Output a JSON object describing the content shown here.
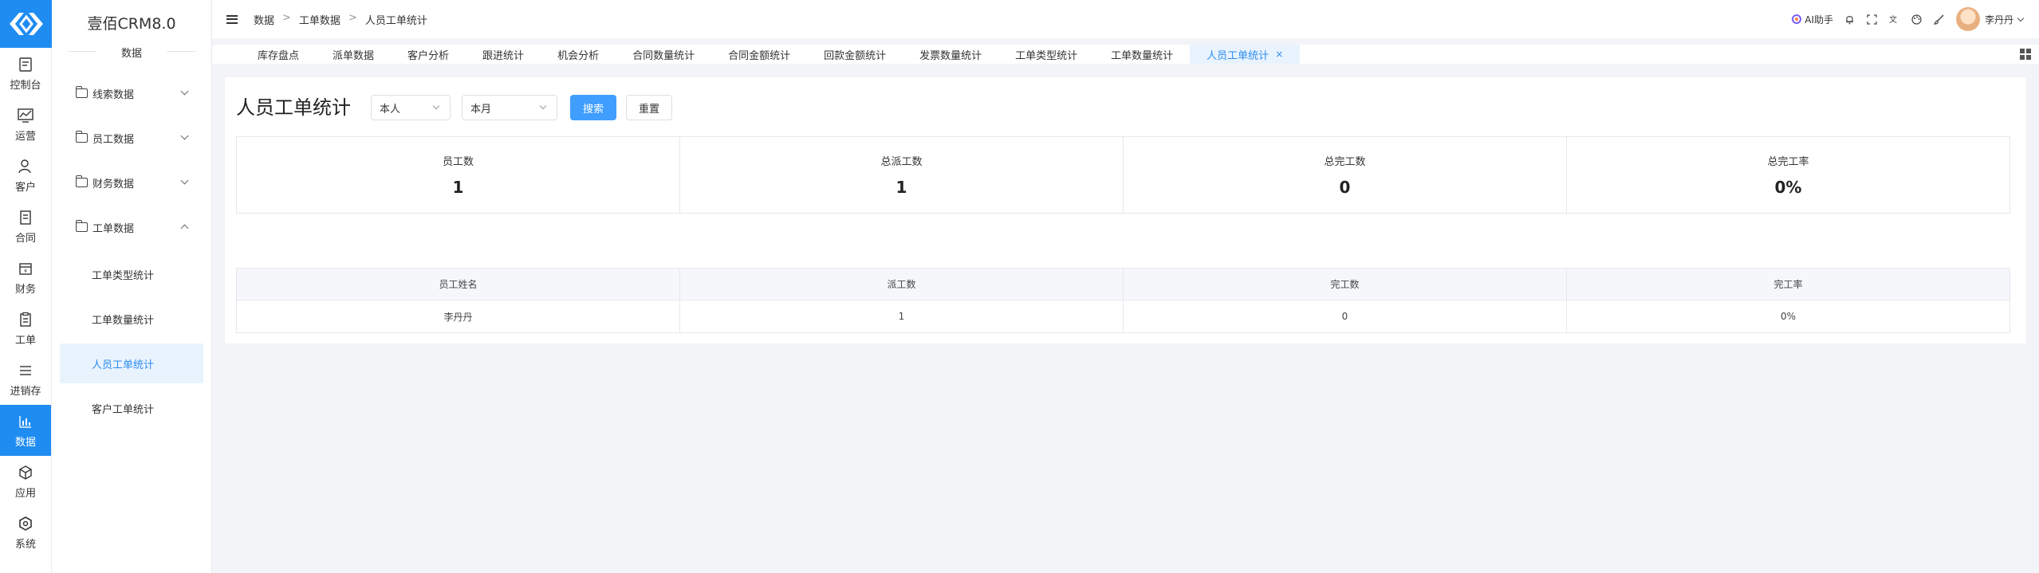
{
  "rail": {
    "items": [
      {
        "label": "控制台",
        "icon": "dashboard-icon"
      },
      {
        "label": "运营",
        "icon": "operation-icon"
      },
      {
        "label": "客户",
        "icon": "customer-icon"
      },
      {
        "label": "合同",
        "icon": "contract-icon"
      },
      {
        "label": "财务",
        "icon": "finance-icon"
      },
      {
        "label": "工单",
        "icon": "workorder-icon"
      },
      {
        "label": "进销存",
        "icon": "inventory-icon"
      },
      {
        "label": "数据",
        "icon": "data-chart-icon"
      },
      {
        "label": "应用",
        "icon": "app-cube-icon"
      },
      {
        "label": "系统",
        "icon": "system-gear-icon"
      }
    ]
  },
  "sidebar": {
    "brand": "壹佰CRM8.0",
    "section": "数据",
    "groups": [
      "线索数据",
      "员工数据",
      "财务数据",
      "工单数据"
    ],
    "leaves": [
      "工单类型统计",
      "工单数量统计",
      "人员工单统计",
      "客户工单统计"
    ]
  },
  "header": {
    "breadcrumb": [
      "数据",
      "工单数据",
      "人员工单统计"
    ],
    "ai_label": "AI助手",
    "user_name": "李丹丹"
  },
  "tabs": [
    "库存盘点",
    "派单数据",
    "客户分析",
    "跟进统计",
    "机会分析",
    "合同数量统计",
    "合同金额统计",
    "回款金额统计",
    "发票数量统计",
    "工单类型统计",
    "工单数量统计",
    "人员工单统计"
  ],
  "tab_close": "×",
  "main": {
    "title": "人员工单统计",
    "filter_person": "本人",
    "filter_period": "本月",
    "search_label": "搜索",
    "reset_label": "重置"
  },
  "stats": [
    {
      "label": "员工数",
      "value": "1"
    },
    {
      "label": "总派工数",
      "value": "1"
    },
    {
      "label": "总完工数",
      "value": "0"
    },
    {
      "label": "总完工率",
      "value": "0%"
    }
  ],
  "table": {
    "columns": [
      "员工姓名",
      "派工数",
      "完工数",
      "完工率"
    ],
    "rows": [
      [
        "李丹丹",
        "1",
        "0",
        "0%"
      ]
    ]
  }
}
